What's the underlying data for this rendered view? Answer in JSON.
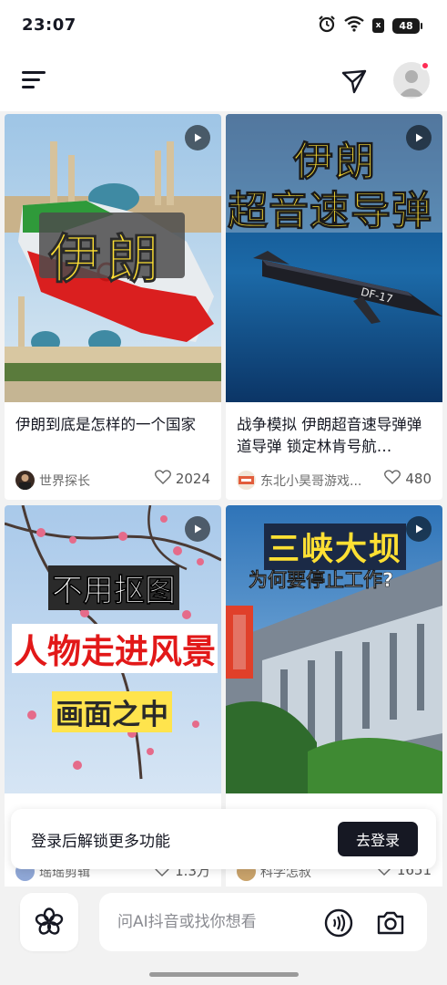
{
  "status_bar": {
    "time": "23:07",
    "battery": "48",
    "sim_label": "x",
    "icons": [
      "alarm-icon",
      "wifi-icon",
      "sim-icon",
      "battery-icon"
    ]
  },
  "top_bar": {
    "icons": [
      "menu-icon",
      "send-icon",
      "avatar-icon"
    ],
    "has_notification_dot": true,
    "accent_color": "#fe2c55"
  },
  "feed": {
    "cards": [
      {
        "title": "伊朗到底是怎样的一个国家",
        "author": "世界探长",
        "likes": "2024",
        "thumb_text": [
          "伊朗"
        ]
      },
      {
        "title": "战争模拟 伊朗超音速导弹弹道导弹 锁定林肯号航…",
        "author": "东北小昊哥游戏...",
        "likes": "480",
        "thumb_text": [
          "伊朗",
          "超音速导弹",
          "DF-17"
        ]
      },
      {
        "title": "",
        "author": "瑶瑶剪辑",
        "likes": "1.3万",
        "thumb_text": [
          "不用抠图",
          "人物走进风景",
          "画面之中"
        ]
      },
      {
        "title": "",
        "author": "科学怎叔",
        "likes": "1651",
        "thumb_text": [
          "三峡大坝",
          "为何要停止工作?"
        ]
      }
    ]
  },
  "login_banner": {
    "text": "登录后解锁更多功能",
    "button_label": "去登录"
  },
  "bottom_bar": {
    "search_placeholder": "问AI抖音或找你想看",
    "icons": [
      "flower-icon",
      "voice-icon",
      "camera-icon"
    ]
  }
}
